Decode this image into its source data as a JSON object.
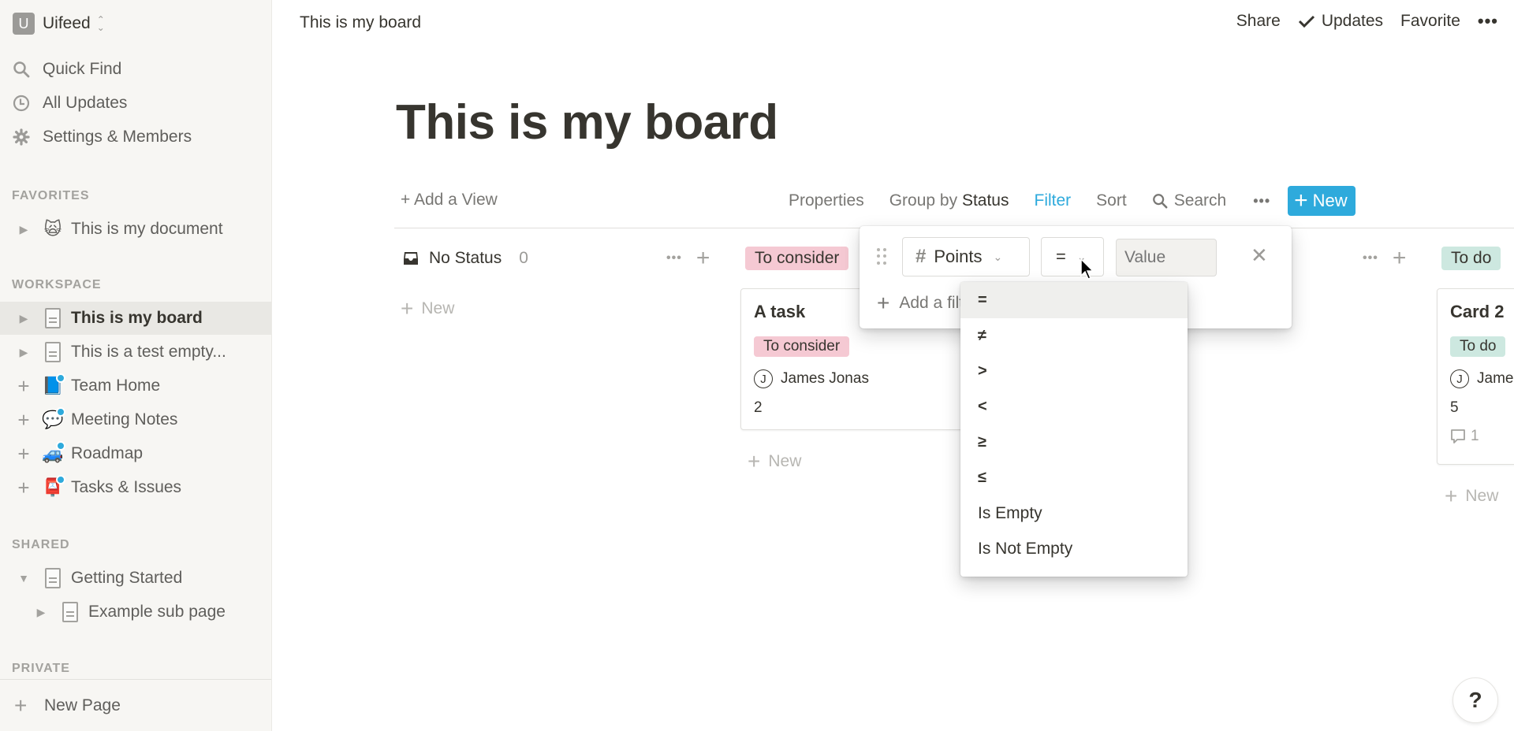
{
  "workspace": {
    "initial": "U",
    "name": "Uifeed"
  },
  "nav": [
    {
      "icon": "search-icon",
      "label": "Quick Find"
    },
    {
      "icon": "clock-icon",
      "label": "All Updates"
    },
    {
      "icon": "gear-icon",
      "label": "Settings & Members"
    }
  ],
  "sections": {
    "favorites": "FAVORITES",
    "workspace": "WORKSPACE",
    "shared": "SHARED",
    "private": "PRIVATE"
  },
  "favorites": [
    {
      "label": "This is my document",
      "emoji": "🙀"
    }
  ],
  "workspace_pages": [
    {
      "label": "This is my board",
      "icon": "page",
      "active": true
    },
    {
      "label": "This is a test empty...",
      "icon": "page"
    },
    {
      "label": "Team Home",
      "emoji": "📘"
    },
    {
      "label": "Meeting Notes",
      "emoji": "💬"
    },
    {
      "label": "Roadmap",
      "emoji": "🚙"
    },
    {
      "label": "Tasks & Issues",
      "emoji": "📮"
    }
  ],
  "shared_pages": [
    {
      "label": "Getting Started",
      "expanded": true
    },
    {
      "label": "Example sub page"
    }
  ],
  "new_page_label": "New Page",
  "topbar": {
    "breadcrumb": "This is my board",
    "share": "Share",
    "updates": "Updates",
    "favorite": "Favorite"
  },
  "page": {
    "title": "This is my board"
  },
  "toolbar": {
    "add_view": "+ Add a View",
    "properties": "Properties",
    "group_by_prefix": "Group by",
    "group_by_value": "Status",
    "filter": "Filter",
    "sort": "Sort",
    "search": "Search",
    "new": "New"
  },
  "board": {
    "columns": [
      {
        "title": "No Status",
        "count": "0",
        "new_label": "New"
      },
      {
        "title": "To consider",
        "color": "#f5c9d3",
        "new_label": "New"
      },
      {
        "title": "To do",
        "color": "#cde8e0",
        "new_label": "New"
      }
    ],
    "cards": [
      {
        "title": "A task",
        "status": "To consider",
        "person_initial": "J",
        "person": "James Jonas",
        "points": "2"
      },
      {
        "title": "Card 2",
        "status": "To do",
        "person_initial": "J",
        "person": "James Jonas",
        "points": "5",
        "comments": "1"
      }
    ]
  },
  "filter_popup": {
    "property": "Points",
    "operator": "=",
    "value_placeholder": "Value",
    "add_filter": "Add a filter"
  },
  "operator_menu": {
    "selected": "=",
    "options": [
      "=",
      "≠",
      ">",
      "<",
      "≥",
      "≤",
      "Is Empty",
      "Is Not Empty"
    ]
  },
  "help": "?"
}
